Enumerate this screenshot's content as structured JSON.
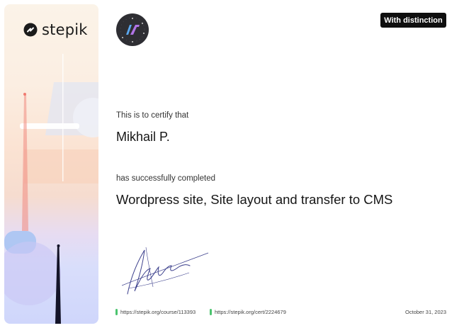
{
  "brand": {
    "name": "stepik"
  },
  "badge": {
    "label": "With distinction"
  },
  "certificate": {
    "intro": "This is to certify that",
    "recipient": "Mikhail P.",
    "completed_text": "has successfully completed",
    "course_title": "Wordpress site, Site layout and transfer to CMS"
  },
  "footer": {
    "course_link": "https://stepik.org/course/113393",
    "cert_link": "https://stepik.org/cert/2224679",
    "date": "October 31, 2023"
  },
  "colors": {
    "badge_bg": "#0f0f0f",
    "link_marker": "#4cc46f"
  }
}
